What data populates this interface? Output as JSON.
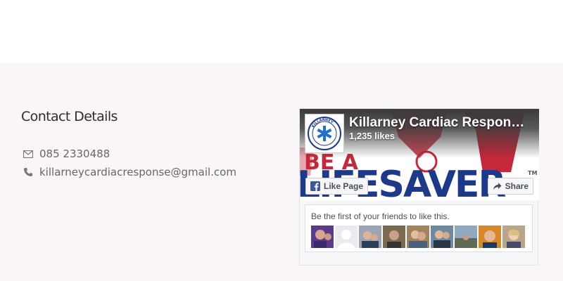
{
  "contact": {
    "title": "Contact Details",
    "phone": "085 2330488",
    "email": "killarneycardiacresponse@gmail.com"
  },
  "facebook": {
    "page_name": "Killarney Cardiac Respon…",
    "likes": "1,235 likes",
    "like_button": "Like Page",
    "share_button": "Share",
    "friends_text": "Be the first of your friends to like this.",
    "cover_text_small": "BE A",
    "cover_text_large": "LIFESAVER",
    "cover_tm": "TM",
    "logo_text": "KILLARNEY",
    "faces": [
      "friend-1",
      "friend-2",
      "friend-3",
      "friend-4",
      "friend-5",
      "friend-6",
      "friend-7",
      "friend-8",
      "friend-9",
      "friend-10"
    ]
  },
  "colors": {
    "footer_bg": "#faf6f7",
    "fb_blue": "#3b5998",
    "cover_red": "#c4283a",
    "cover_navy": "#1d3a8a"
  }
}
